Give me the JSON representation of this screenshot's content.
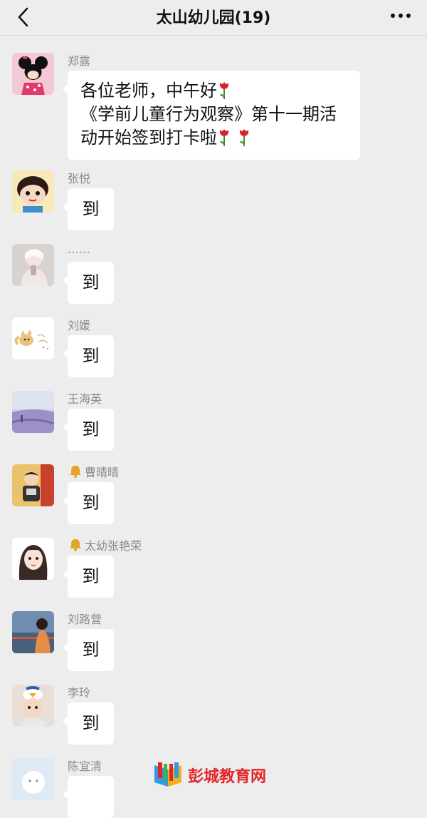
{
  "header": {
    "title": "太山幼儿园(19)",
    "back_icon": "chevron-left-icon",
    "more_icon": "more-dots-icon"
  },
  "messages": [
    {
      "sender": "郑露",
      "bell": false,
      "lines": [
        "各位老师，中午好",
        "《学前儿童行为观察》第十一期活",
        "动开始签到打卡啦"
      ],
      "emoji": "tulip-emoji"
    },
    {
      "sender": "张悦",
      "bell": false,
      "text": "到"
    },
    {
      "sender": "……",
      "bell": false,
      "text": "到"
    },
    {
      "sender": "刘媛",
      "bell": false,
      "text": "到"
    },
    {
      "sender": "王海英",
      "bell": false,
      "text": "到"
    },
    {
      "sender": "曹晴晴",
      "bell": true,
      "text": "到"
    },
    {
      "sender": "太幼张艳荣",
      "bell": true,
      "text": "到"
    },
    {
      "sender": "刘路营",
      "bell": false,
      "text": "到"
    },
    {
      "sender": "李玲",
      "bell": false,
      "text": "到"
    },
    {
      "sender": "陈宜清",
      "bell": false,
      "text": ""
    }
  ],
  "watermark": {
    "text": "彭城教育网"
  },
  "colors": {
    "background": "#ededed",
    "bubble": "#ffffff",
    "sender_name": "#8a8a8a",
    "watermark": "#e0262a"
  }
}
